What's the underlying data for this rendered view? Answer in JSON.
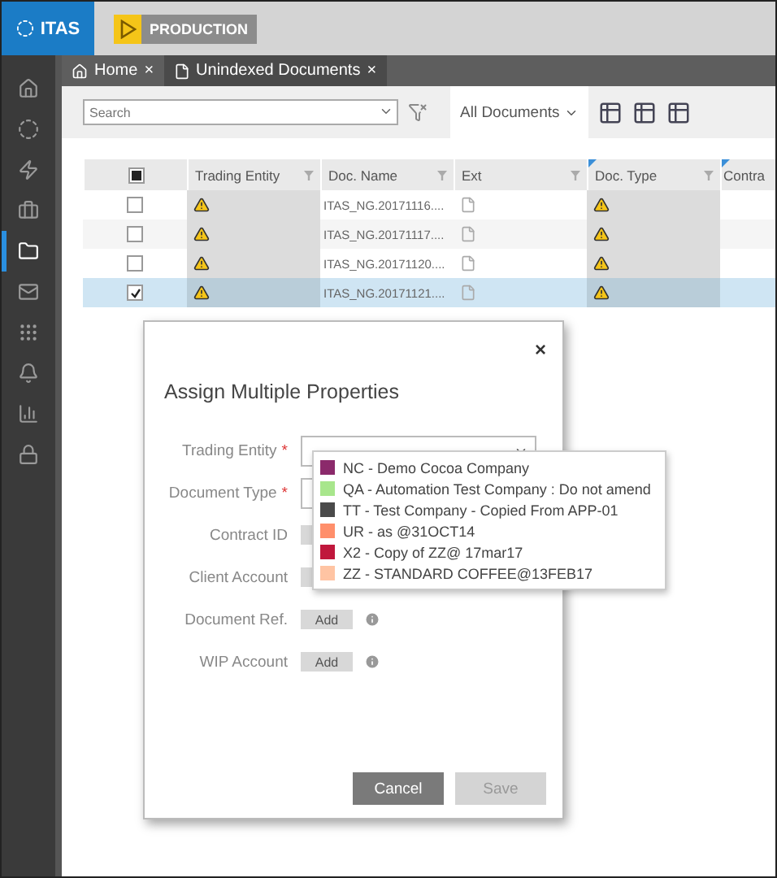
{
  "app": {
    "logo": "ITAS",
    "environment": "PRODUCTION"
  },
  "sidebar": {
    "items": [
      {
        "selected": false
      },
      {
        "selected": false
      },
      {
        "selected": false
      },
      {
        "selected": false
      },
      {
        "selected": true
      },
      {
        "selected": false
      },
      {
        "selected": false
      },
      {
        "selected": false
      },
      {
        "selected": false
      },
      {
        "selected": false
      }
    ]
  },
  "tabs": [
    {
      "label": "Home",
      "close": "×",
      "selected": false
    },
    {
      "label": "Unindexed Documents",
      "close": "×",
      "selected": true
    }
  ],
  "toolbar": {
    "search": {
      "placeholder": "Search"
    },
    "view": "All Documents"
  },
  "table": {
    "select_all": {
      "indeterminate": true
    },
    "columns": [
      {
        "label": "Trading Entity",
        "flagged": false
      },
      {
        "label": "Doc. Name",
        "flagged": false
      },
      {
        "label": "Ext",
        "flagged": false
      },
      {
        "label": "Doc. Type",
        "flagged": true
      },
      {
        "label": "Contra",
        "flagged": true
      }
    ],
    "rows": [
      {
        "checked": false,
        "name": "ITAS_NG.20171116...."
      },
      {
        "checked": false,
        "name": "ITAS_NG.20171117...."
      },
      {
        "checked": false,
        "name": "ITAS_NG.20171120...."
      },
      {
        "checked": true,
        "name": "ITAS_NG.20171121...."
      }
    ]
  },
  "modal": {
    "title": "Assign Multiple Properties",
    "close": "×",
    "fields": [
      {
        "label": "Trading Entity",
        "required_mark": "*",
        "kind": "select"
      },
      {
        "label": "Document Type",
        "required_mark": "*",
        "kind": "select"
      },
      {
        "label": "Contract ID",
        "kind": "add"
      },
      {
        "label": "Client Account",
        "kind": "add"
      },
      {
        "label": "Document Ref.",
        "kind": "add",
        "button": "Add"
      },
      {
        "label": "WIP Account",
        "kind": "add",
        "button": "Add"
      }
    ],
    "dropdown": [
      {
        "label": "NC - Demo Cocoa Company",
        "color": "#8b2a6b"
      },
      {
        "label": "QA - Automation Test Company : Do not amend",
        "color": "#a8e68c"
      },
      {
        "label": "TT - Test Company - Copied From APP-01",
        "color": "#4a4a4a"
      },
      {
        "label": "UR - as @31OCT14",
        "color": "#ff8f6b"
      },
      {
        "label": "X2 - Copy of ZZ@ 17mar17",
        "color": "#c0173c"
      },
      {
        "label": "ZZ - STANDARD COFFEE@13FEB17",
        "color": "#ffc4a3"
      }
    ],
    "buttons": [
      {
        "label": "Cancel",
        "primary": true
      },
      {
        "label": "Save",
        "primary": false
      }
    ]
  }
}
